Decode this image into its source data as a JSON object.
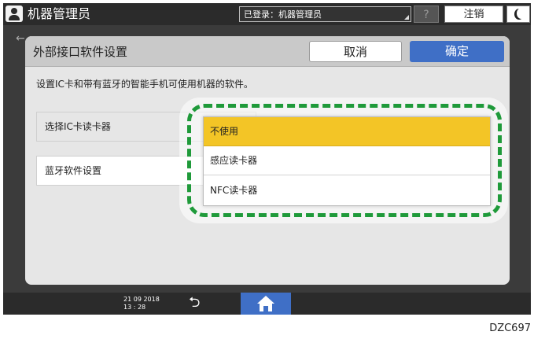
{
  "topbar": {
    "title": "机器管理员",
    "login_status": "已登录：机器管理员",
    "help_label": "?",
    "logout_label": "注销"
  },
  "dialog": {
    "title": "外部接口软件设置",
    "cancel_label": "取消",
    "ok_label": "确定",
    "description": "设置IC卡和带有蓝牙的智能手机可使用机器的软件。",
    "rows": [
      {
        "label": "选择IC卡读卡器"
      },
      {
        "label": "蓝牙软件设置"
      }
    ],
    "dropdown": {
      "selected_index": 0,
      "options": [
        "不使用",
        "感应读卡器",
        "NFC读卡器"
      ]
    }
  },
  "bottombar": {
    "date": "21 09 2018",
    "time": "13 : 28"
  },
  "figure_code": "DZC697",
  "colors": {
    "accent_blue": "#3f6fc6",
    "highlight_yellow": "#f3c526",
    "annotation_green": "#1f9a3a"
  },
  "icons": [
    "user-icon",
    "help-icon",
    "moon-icon",
    "back-arrow-icon",
    "home-icon"
  ]
}
